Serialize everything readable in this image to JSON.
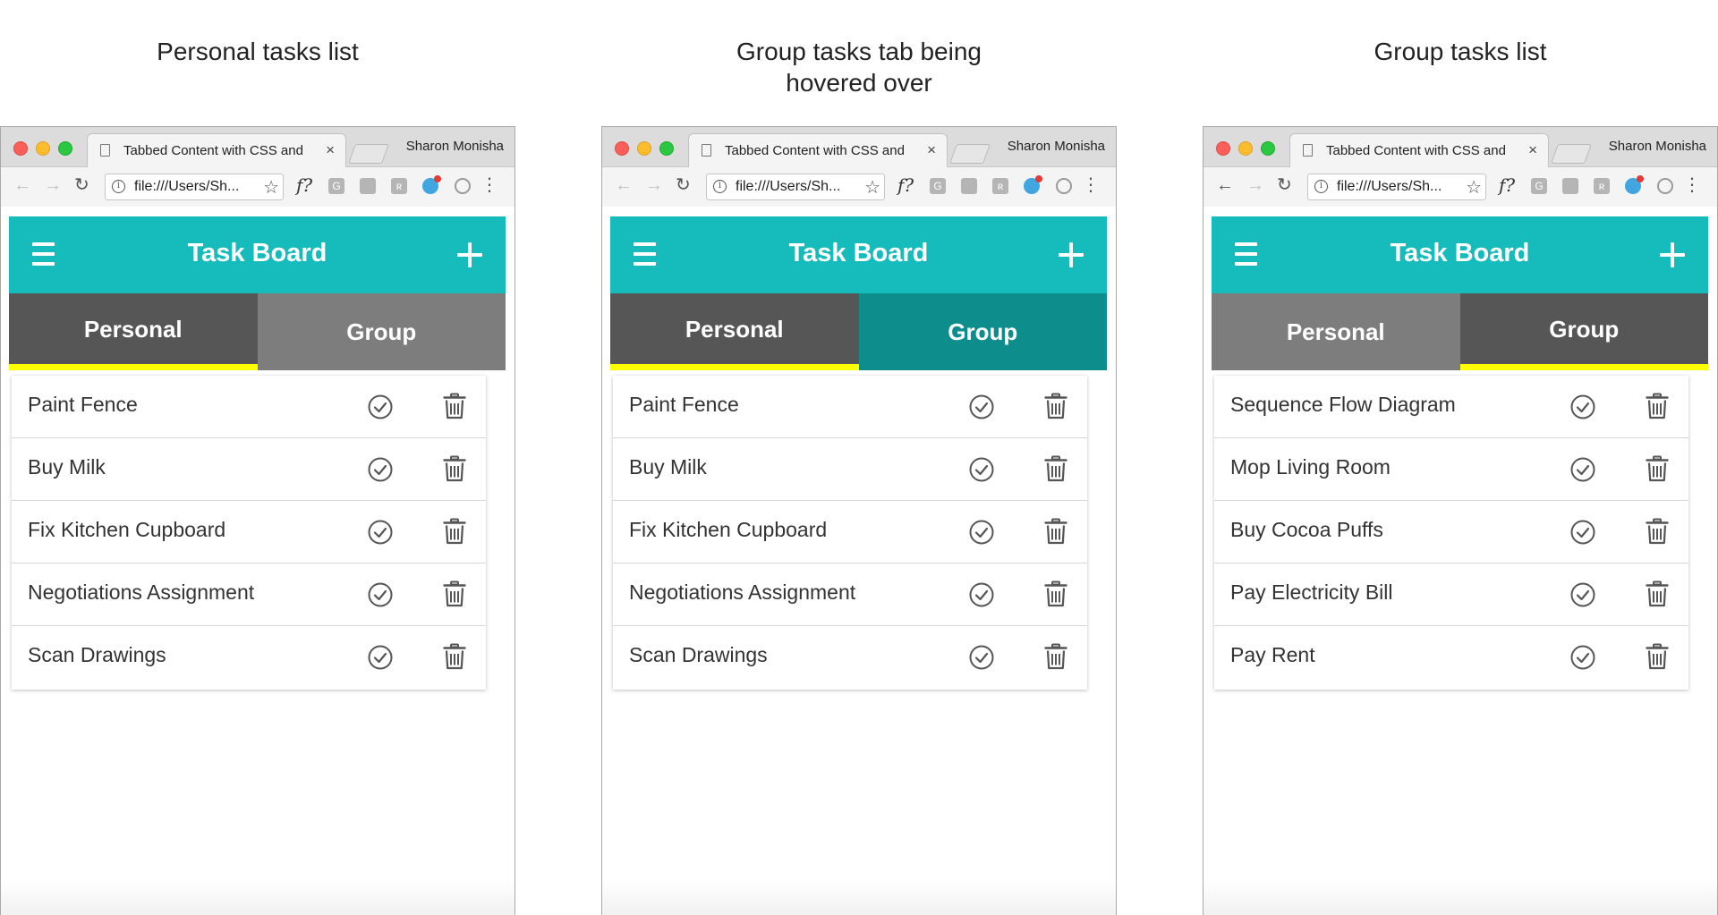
{
  "browser": {
    "tab_title": "Tabbed Content with CSS and",
    "tab_close": "×",
    "profile_name": "Sharon Monisha",
    "url": "file:///Users/Sh...",
    "info_symbol": "i",
    "ext_f_label": "f?",
    "ext_g_label": "G",
    "ext_k_label": "ʀ",
    "back_symbol": "←",
    "forward_symbol": "→",
    "reload_symbol": "↻",
    "star_symbol": "☆",
    "menu_symbol": "⋮"
  },
  "app": {
    "title": "Task Board",
    "tab_personal": "Personal",
    "tab_group": "Group"
  },
  "colors": {
    "header": "#16bcbc",
    "tab_active": "#565656",
    "tab_inactive": "#7d7d7d",
    "tab_hover": "#0d8e8c",
    "tab_indicator": "#ffff00"
  },
  "panels": [
    {
      "caption_line1": "Personal tasks list",
      "caption_line2": "",
      "active_tab": "personal",
      "hover_tab": "",
      "tasks": [
        {
          "text": "Paint Fence"
        },
        {
          "text": "Buy Milk"
        },
        {
          "text": "Fix Kitchen Cupboard"
        },
        {
          "text": "Negotiations Assignment"
        },
        {
          "text": "Scan Drawings"
        }
      ]
    },
    {
      "caption_line1": "Group tasks tab being",
      "caption_line2": "hovered over",
      "active_tab": "personal",
      "hover_tab": "group",
      "tasks": [
        {
          "text": "Paint Fence"
        },
        {
          "text": "Buy Milk"
        },
        {
          "text": "Fix Kitchen Cupboard"
        },
        {
          "text": "Negotiations Assignment"
        },
        {
          "text": "Scan Drawings"
        }
      ]
    },
    {
      "caption_line1": "Group tasks list",
      "caption_line2": "",
      "active_tab": "group",
      "hover_tab": "",
      "tasks": [
        {
          "text": "Sequence Flow Diagram"
        },
        {
          "text": "Mop Living Room"
        },
        {
          "text": "Buy Cocoa Puffs"
        },
        {
          "text": "Pay Electricity Bill"
        },
        {
          "text": "Pay Rent"
        }
      ]
    }
  ]
}
